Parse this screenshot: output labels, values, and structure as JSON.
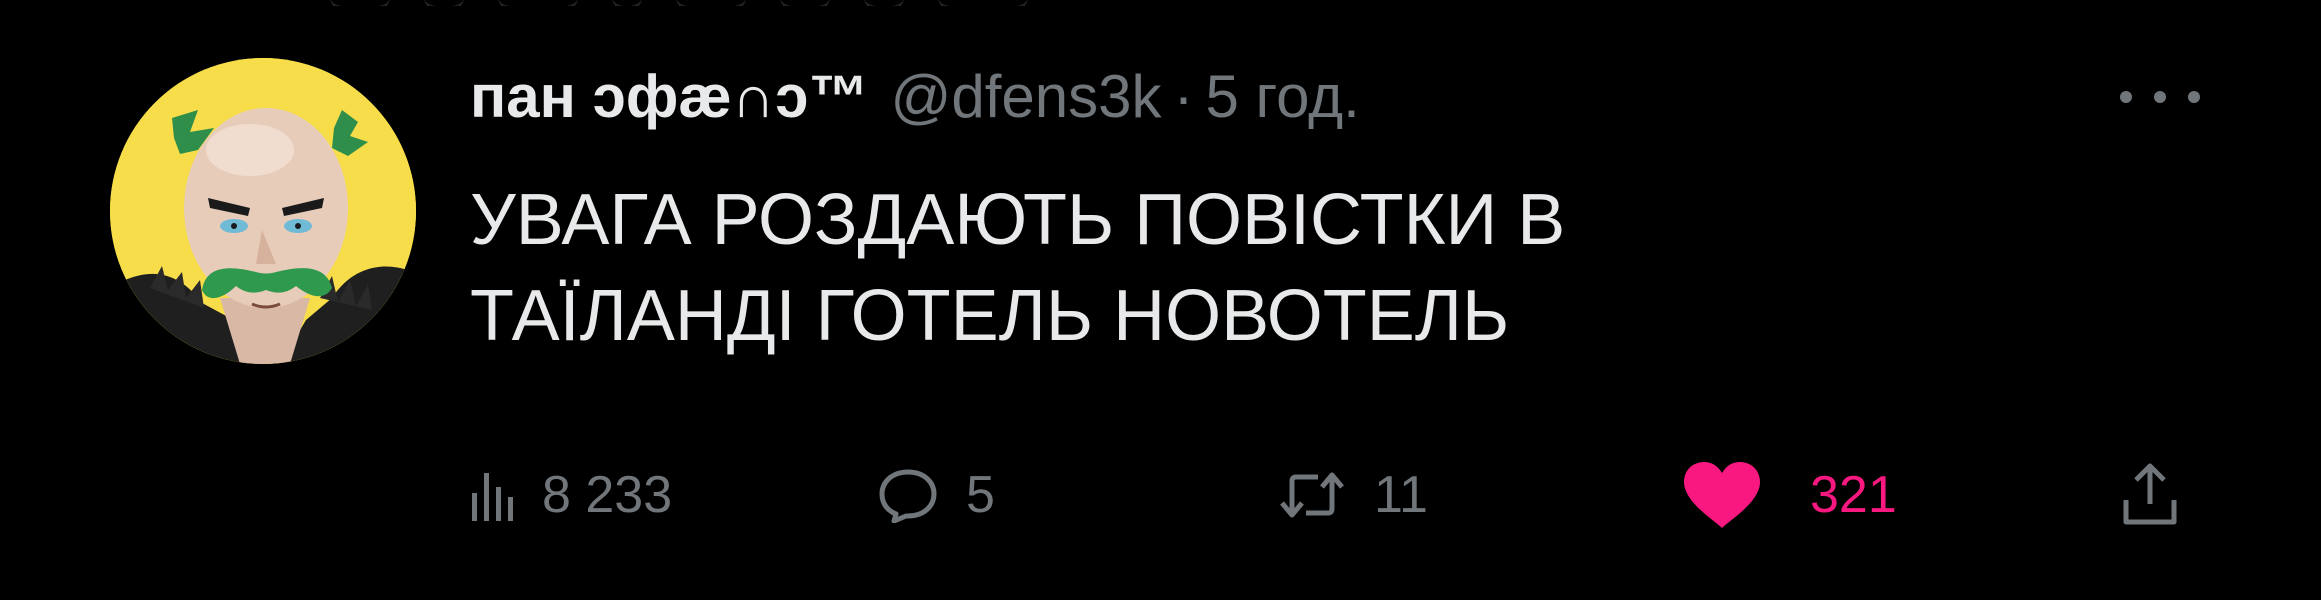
{
  "tweet": {
    "author": {
      "display_name": "пан ↄфæ∩ↄ™",
      "handle": "@dfens3k"
    },
    "separator": "·",
    "time": "5 год.",
    "text_lines": [
      "УВАГА РОЗДАЮТЬ ПОВІСТКИ В",
      "ТАЇЛАНДІ ГОТЕЛЬ НОВОТЕЛЬ"
    ],
    "stats": {
      "views": "8 233",
      "replies": "5",
      "retweets": "11",
      "likes": "321"
    }
  },
  "colors": {
    "background": "#000000",
    "text_primary": "#e7e9ea",
    "text_secondary": "#71767b",
    "like_active": "#f91880",
    "avatar_background": "#f7dd4a"
  },
  "icons": {
    "more": "more-dots-icon",
    "views": "bar-chart-icon",
    "reply": "speech-bubble-icon",
    "retweet": "retweet-icon",
    "like": "heart-filled-icon",
    "share": "share-upload-icon"
  }
}
